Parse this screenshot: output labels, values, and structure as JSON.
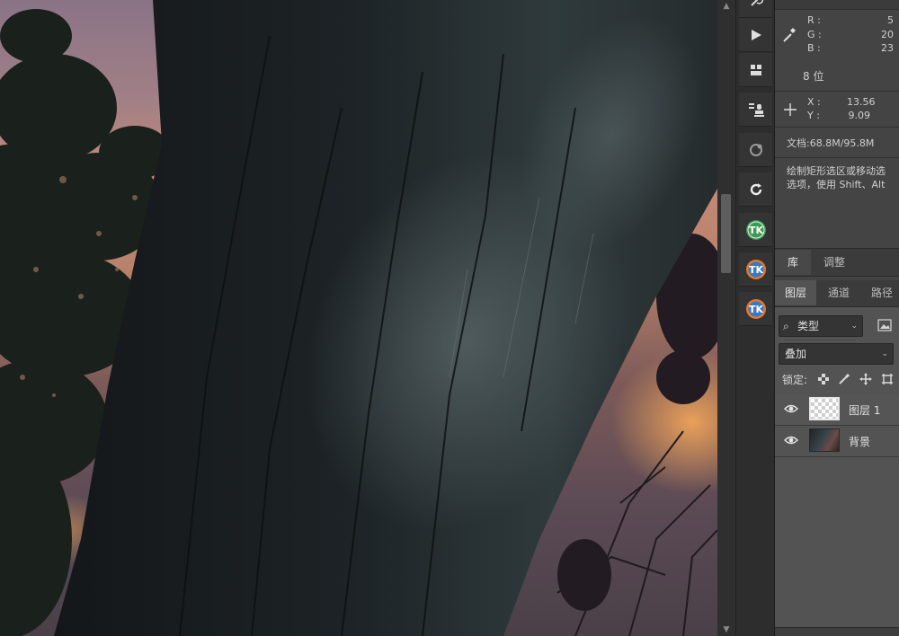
{
  "info_panel": {
    "r_label": "R :",
    "r_value": "5",
    "g_label": "G :",
    "g_value": "20",
    "b_label": "B :",
    "b_value": "23",
    "bit_depth": "8 位",
    "x_label": "X :",
    "x_value": "13.56",
    "y_label": "Y :",
    "y_value": "9.09",
    "doc_size": "文档:68.8M/95.8M",
    "hint_line1": "绘制矩形选区或移动选",
    "hint_line2": "选项，使用 Shift、Alt"
  },
  "library_tabs": [
    "库",
    "调整"
  ],
  "layer_tabs": [
    "图层",
    "通道",
    "路径"
  ],
  "layers_panel": {
    "filter_label": "类型",
    "blend_mode": "叠加",
    "lock_label": "锁定:",
    "layers": [
      {
        "name": "图层 1",
        "selected": true,
        "visible": true
      },
      {
        "name": "背景",
        "selected": false,
        "visible": true
      }
    ]
  },
  "colors": {
    "panel_bg": "#444444",
    "toolstrip_bg": "#2d2d2d",
    "accent_tk_green": "#3c9a54",
    "accent_tk_orange": "#e07a2c"
  },
  "tool_icons": [
    "history-brush-icon",
    "play-icon",
    "3d-cube-icon",
    "clone-stamp-icon",
    "paths-icon",
    "rotate-icon",
    "tk-plugin-icon",
    "tk-plugin-icon",
    "tk-plugin-icon"
  ]
}
